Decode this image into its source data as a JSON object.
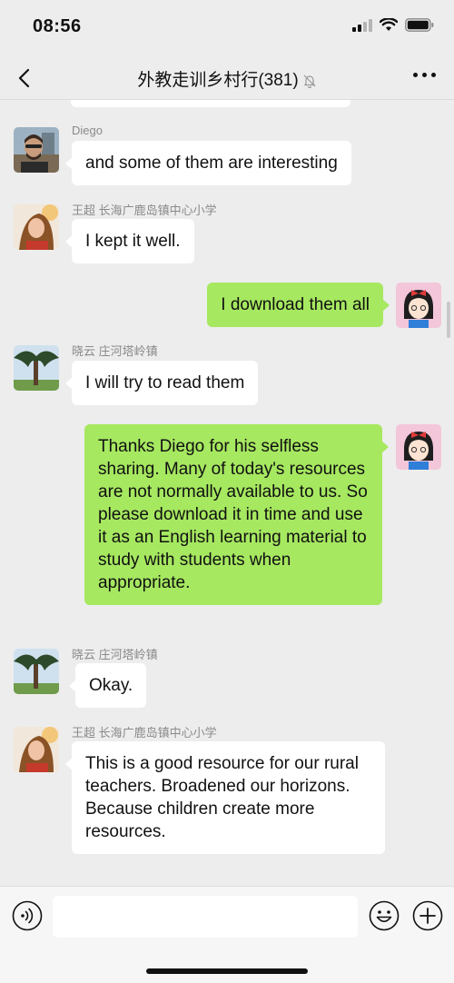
{
  "status_bar": {
    "time": "08:56"
  },
  "header": {
    "title": "外教走训乡村行(381)"
  },
  "messages": [
    {
      "sender": "Diego",
      "text": "and some of them are interesting",
      "direction": "in"
    },
    {
      "sender": "王超 长海广鹿岛镇中心小学",
      "text": "I kept it well.",
      "direction": "in"
    },
    {
      "sender": "",
      "text": "I download them all",
      "direction": "out"
    },
    {
      "sender": "晓云 庄河塔岭镇",
      "text": "I will try to read them",
      "direction": "in"
    },
    {
      "sender": "",
      "text": "Thanks Diego for his selfless sharing. Many of today's resources are not normally available to us. So please download it in time and use it as an English learning material to study with students when appropriate.",
      "direction": "out"
    },
    {
      "sender": "晓云 庄河塔岭镇",
      "text": "Okay.",
      "direction": "in"
    },
    {
      "sender": "王超 长海广鹿岛镇中心小学",
      "text": "This is a good resource for our rural teachers. Broadened our horizons. Because children create more resources.",
      "direction": "in"
    }
  ],
  "input": {
    "value": "",
    "placeholder": ""
  },
  "icons": {
    "back": "chevron-left-icon",
    "mute": "bell-off-icon",
    "more": "more-icon",
    "voice": "voice-icon",
    "emoji": "emoji-icon",
    "plus": "plus-icon"
  },
  "colors": {
    "background": "#ededed",
    "bubble_in": "#ffffff",
    "bubble_out": "#a6e860",
    "sender_text": "#8a8a8a"
  }
}
